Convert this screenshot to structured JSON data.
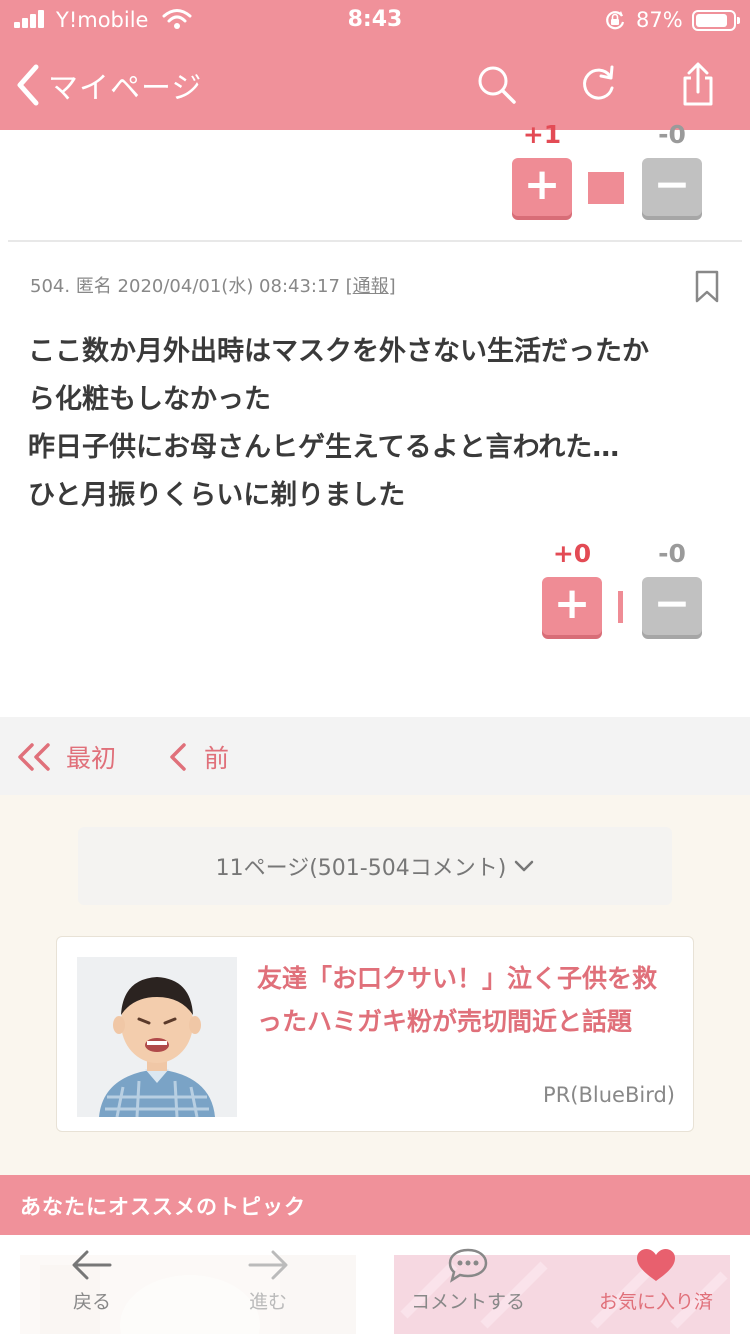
{
  "status_bar": {
    "carrier": "Y!mobile",
    "time": "8:43",
    "battery": "87%",
    "battery_level": 0.87
  },
  "nav": {
    "back_label": "マイページ",
    "icons": [
      "search-icon",
      "reload-icon",
      "share-icon"
    ]
  },
  "prev_comment": {
    "plus": "+1",
    "minus": "-0",
    "plus_button": "+",
    "minus_button": "−"
  },
  "comment": {
    "number": "504.",
    "author": "匿名",
    "datetime": "2020/04/01(水) 08:43:17",
    "report": "通報",
    "lines": [
      "ここ数か月外出時はマスクを外さない生活だったか",
      "ら化粧もしなかった",
      "昨日子供にお母さんヒゲ生えてるよと言われた…",
      "ひと月振りくらいに剃りました"
    ],
    "plus": "+0",
    "minus": "-0",
    "plus_button": "+",
    "minus_button": "−"
  },
  "pager": {
    "first": "最初",
    "prev": "前"
  },
  "page_select": {
    "label": "11ページ(501-504コメント)"
  },
  "ad": {
    "title": "友達「お口クサい！」泣く子供を救ったハミガキ粉が売切間近と話題",
    "sponsor": "PR(BlueBird)"
  },
  "recommend": {
    "title": "あなたにオススメのトピック"
  },
  "toolbar": {
    "back": "戻る",
    "forward": "進む",
    "comment": "コメントする",
    "favorite": "お気に入り済"
  },
  "colors": {
    "accent": "#f0919a",
    "link": "#e0707a",
    "plus": "#e34b55",
    "minus": "#9a9a9a"
  }
}
